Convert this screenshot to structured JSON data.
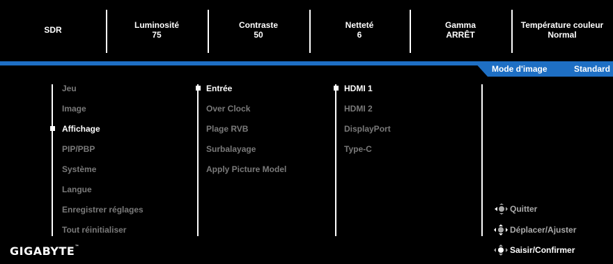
{
  "status_bar": [
    {
      "label": "SDR",
      "value": ""
    },
    {
      "label": "Luminosité",
      "value": "75"
    },
    {
      "label": "Contraste",
      "value": "50"
    },
    {
      "label": "Netteté",
      "value": "6"
    },
    {
      "label": "Gamma",
      "value": "ARRÊT"
    },
    {
      "label": "Température couleur",
      "value": "Normal"
    }
  ],
  "mode_tab": {
    "label": "Mode d'image",
    "value": "Standard"
  },
  "menu_main": [
    "Jeu",
    "Image",
    "Affichage",
    "PIP/PBP",
    "Système",
    "Langue",
    "Enregistrer réglages",
    "Tout réinitialiser"
  ],
  "menu_main_selected": "Affichage",
  "menu_sub": [
    "Entrée",
    "Over Clock",
    "Plage RVB",
    "Surbalayage",
    "Apply Picture Model"
  ],
  "menu_sub_selected": "Entrée",
  "menu_input": [
    "HDMI 1",
    "HDMI 2",
    "DisplayPort",
    "Type-C"
  ],
  "menu_input_selected": "HDMI 1",
  "controls": [
    {
      "label": "Quitter",
      "icon": "joystick-left-icon"
    },
    {
      "label": "Déplacer/Ajuster",
      "icon": "joystick-move-icon"
    },
    {
      "label": "Saisir/Confirmer",
      "icon": "joystick-press-icon"
    }
  ],
  "brand": "GIGABYTE",
  "colors": {
    "accent": "#1e6fc4",
    "background": "#000000",
    "dim_text": "#7a7a7a"
  }
}
